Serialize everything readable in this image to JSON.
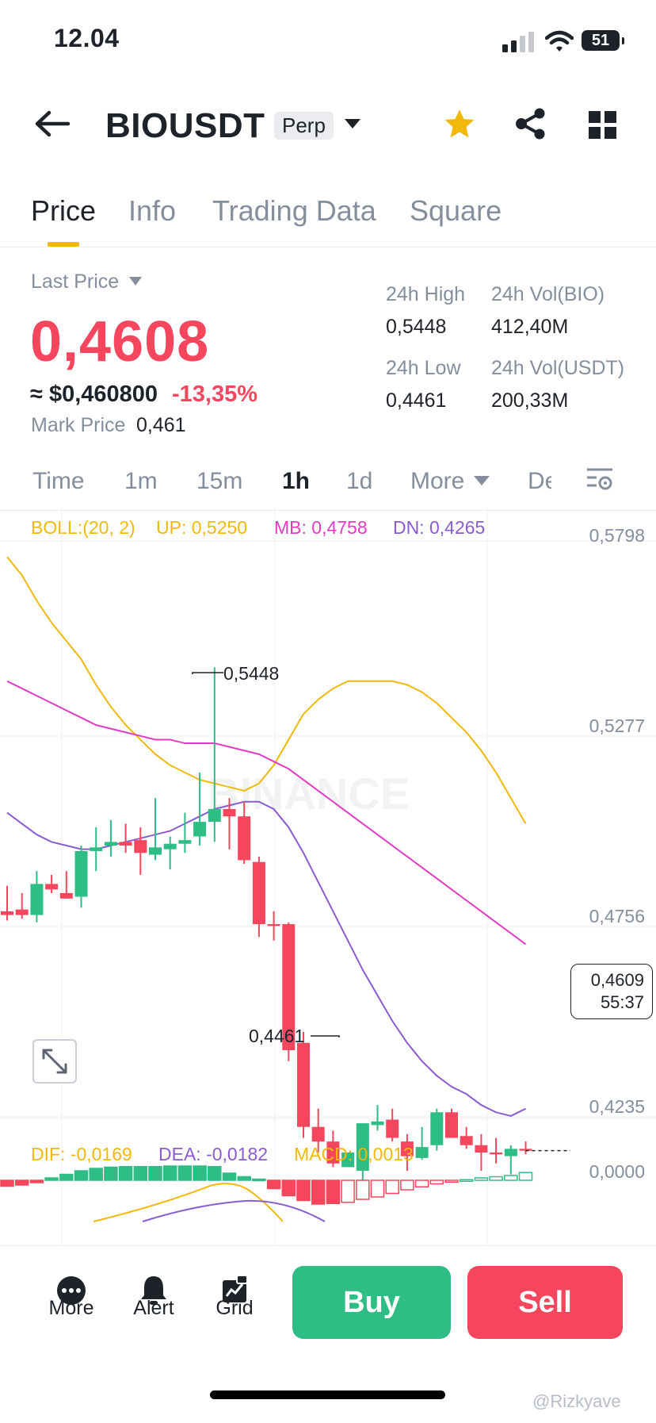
{
  "status_bar": {
    "time": "12.04",
    "battery": "51"
  },
  "header": {
    "symbol": "BIOUSDT",
    "badge": "Perp",
    "icons": [
      "back-arrow-icon",
      "chevron-down-icon",
      "star-icon",
      "share-icon",
      "grid-menu-icon"
    ]
  },
  "tabs": [
    "Price",
    "Info",
    "Trading Data",
    "Square"
  ],
  "price": {
    "label": "Last Price",
    "last": "0,4608",
    "usd": "≈ $0,460800",
    "change": "-13,35%",
    "mark_label": "Mark Price",
    "mark": "0,461"
  },
  "stats": {
    "high_label": "24h High",
    "high": "0,5448",
    "vol_bio_label": "24h Vol(BIO)",
    "vol_bio": "412,40M",
    "low_label": "24h Low",
    "low": "0,4461",
    "vol_usdt_label": "24h Vol(USDT)",
    "vol_usdt": "200,33M"
  },
  "timeframes": [
    "Time",
    "1m",
    "15m",
    "1h",
    "1d",
    "More",
    "De"
  ],
  "active_timeframe": "1h",
  "boll": {
    "label": "BOLL:(20, 2)",
    "up": "UP: 0,5250",
    "mb": "MB: 0,4758",
    "dn": "DN: 0,4265"
  },
  "macd": {
    "dif": "DIF: -0,0169",
    "dea": "DEA: -0,0182",
    "macd": "MACD: 0,0013"
  },
  "price_axis": [
    "0,5798",
    "0,5277",
    "0,4756",
    "0,4235"
  ],
  "macd_axis": "0,0000",
  "annotations": {
    "high": "0,5448",
    "low": "0,4461"
  },
  "current_tag": {
    "price": "0,4609",
    "countdown": "55:37"
  },
  "watermark": "BINANCE",
  "bottom": {
    "more": "More",
    "alert": "Alert",
    "grid": "Grid",
    "buy": "Buy",
    "sell": "Sell"
  },
  "credit": "@Rizkyave",
  "colors": {
    "up": "#2ebd85",
    "down": "#f6465d",
    "accent": "#f0b90b",
    "boll_up": "#f0b90b",
    "boll_mb": "#e23cc3",
    "boll_dn": "#8a5cd1"
  },
  "chart_data": {
    "type": "candlestick",
    "candles": [
      {
        "o": 0.478,
        "h": 0.485,
        "l": 0.4755,
        "c": 0.477
      },
      {
        "o": 0.4785,
        "h": 0.483,
        "l": 0.476,
        "c": 0.477
      },
      {
        "o": 0.477,
        "h": 0.489,
        "l": 0.475,
        "c": 0.4855
      },
      {
        "o": 0.4855,
        "h": 0.488,
        "l": 0.483,
        "c": 0.484
      },
      {
        "o": 0.483,
        "h": 0.489,
        "l": 0.4815,
        "c": 0.4815
      },
      {
        "o": 0.482,
        "h": 0.496,
        "l": 0.479,
        "c": 0.4945
      },
      {
        "o": 0.4945,
        "h": 0.501,
        "l": 0.489,
        "c": 0.4955
      },
      {
        "o": 0.496,
        "h": 0.503,
        "l": 0.493,
        "c": 0.497
      },
      {
        "o": 0.497,
        "h": 0.502,
        "l": 0.494,
        "c": 0.496
      },
      {
        "o": 0.4975,
        "h": 0.501,
        "l": 0.488,
        "c": 0.494
      },
      {
        "o": 0.4935,
        "h": 0.509,
        "l": 0.492,
        "c": 0.4955
      },
      {
        "o": 0.495,
        "h": 0.4985,
        "l": 0.4895,
        "c": 0.4965
      },
      {
        "o": 0.4965,
        "h": 0.505,
        "l": 0.494,
        "c": 0.4975
      },
      {
        "o": 0.4985,
        "h": 0.516,
        "l": 0.496,
        "c": 0.5025
      },
      {
        "o": 0.5025,
        "h": 0.5448,
        "l": 0.497,
        "c": 0.506
      },
      {
        "o": 0.506,
        "h": 0.509,
        "l": 0.495,
        "c": 0.504
      },
      {
        "o": 0.504,
        "h": 0.508,
        "l": 0.491,
        "c": 0.492
      },
      {
        "o": 0.4915,
        "h": 0.493,
        "l": 0.471,
        "c": 0.4745
      },
      {
        "o": 0.4745,
        "h": 0.478,
        "l": 0.47,
        "c": 0.474
      },
      {
        "o": 0.4745,
        "h": 0.475,
        "l": 0.437,
        "c": 0.44
      },
      {
        "o": 0.442,
        "h": 0.445,
        "l": 0.416,
        "c": 0.419
      },
      {
        "o": 0.419,
        "h": 0.424,
        "l": 0.412,
        "c": 0.415
      },
      {
        "o": 0.415,
        "h": 0.418,
        "l": 0.408,
        "c": 0.409
      },
      {
        "o": 0.408,
        "h": 0.411,
        "l": 0.4461,
        "c": 0.412
      },
      {
        "o": 0.407,
        "h": 0.42,
        "l": 0.403,
        "c": 0.42
      },
      {
        "o": 0.4195,
        "h": 0.425,
        "l": 0.418,
        "c": 0.4205
      },
      {
        "o": 0.421,
        "h": 0.424,
        "l": 0.415,
        "c": 0.416
      },
      {
        "o": 0.415,
        "h": 0.417,
        "l": 0.407,
        "c": 0.411
      },
      {
        "o": 0.4105,
        "h": 0.419,
        "l": 0.41,
        "c": 0.4135
      },
      {
        "o": 0.414,
        "h": 0.424,
        "l": 0.4125,
        "c": 0.423
      },
      {
        "o": 0.423,
        "h": 0.424,
        "l": 0.416,
        "c": 0.416
      },
      {
        "o": 0.4165,
        "h": 0.419,
        "l": 0.413,
        "c": 0.414
      },
      {
        "o": 0.414,
        "h": 0.417,
        "l": 0.407,
        "c": 0.412
      },
      {
        "o": 0.412,
        "h": 0.416,
        "l": 0.409,
        "c": 0.4115
      },
      {
        "o": 0.411,
        "h": 0.414,
        "l": 0.406,
        "c": 0.413
      },
      {
        "o": 0.413,
        "h": 0.415,
        "l": 0.4115,
        "c": 0.4125
      }
    ],
    "boll_up": [
      0.575,
      0.57,
      0.563,
      0.557,
      0.552,
      0.547,
      0.54,
      0.534,
      0.529,
      0.525,
      0.521,
      0.518,
      0.516,
      0.514,
      0.513,
      0.512,
      0.511,
      0.513,
      0.518,
      0.525,
      0.532,
      0.536,
      0.539,
      0.541,
      0.541,
      0.541,
      0.541,
      0.54,
      0.538,
      0.535,
      0.531,
      0.527,
      0.522,
      0.516,
      0.509,
      0.502
    ],
    "boll_mb": [
      0.541,
      0.539,
      0.537,
      0.535,
      0.533,
      0.531,
      0.529,
      0.528,
      0.527,
      0.526,
      0.525,
      0.525,
      0.524,
      0.524,
      0.524,
      0.523,
      0.522,
      0.521,
      0.519,
      0.517,
      0.514,
      0.511,
      0.508,
      0.505,
      0.502,
      0.499,
      0.496,
      0.493,
      0.49,
      0.487,
      0.484,
      0.481,
      0.478,
      0.475,
      0.472,
      0.469
    ],
    "boll_dn": [
      0.505,
      0.502,
      0.499,
      0.497,
      0.496,
      0.495,
      0.495,
      0.496,
      0.497,
      0.498,
      0.499,
      0.5,
      0.502,
      0.504,
      0.506,
      0.507,
      0.508,
      0.508,
      0.506,
      0.501,
      0.494,
      0.486,
      0.478,
      0.47,
      0.462,
      0.455,
      0.448,
      0.442,
      0.437,
      0.433,
      0.43,
      0.428,
      0.425,
      0.423,
      0.422,
      0.424
    ],
    "macd_hist": [
      -0.001,
      -0.0008,
      -0.0004,
      0.0004,
      0.001,
      0.0016,
      0.002,
      0.0022,
      0.0023,
      0.0023,
      0.0023,
      0.0024,
      0.0024,
      0.0024,
      0.0023,
      0.0012,
      0.0006,
      0.0002,
      -0.0014,
      -0.0026,
      -0.0034,
      -0.004,
      -0.0039,
      -0.0037,
      -0.0032,
      -0.0028,
      -0.0022,
      -0.0016,
      -0.0011,
      -0.0006,
      -0.0003,
      0.0001,
      0.0004,
      0.0006,
      0.0008,
      0.0013
    ],
    "ylim": [
      0.4235,
      0.5798
    ]
  }
}
